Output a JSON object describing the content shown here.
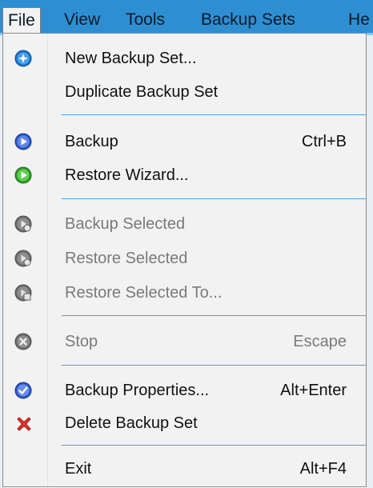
{
  "menubar": {
    "items": [
      {
        "label": "File"
      },
      {
        "label": "View"
      },
      {
        "label": "Tools"
      },
      {
        "label": "Backup Sets"
      },
      {
        "label": "He"
      }
    ]
  },
  "file_menu": {
    "items": [
      {
        "label": "New Backup Set...",
        "shortcut": "",
        "icon": "new-backup-set-icon"
      },
      {
        "label": "Duplicate Backup Set",
        "shortcut": "",
        "icon": ""
      },
      {
        "label": "Backup",
        "shortcut": "Ctrl+B",
        "icon": "backup-play-icon"
      },
      {
        "label": "Restore Wizard...",
        "shortcut": "",
        "icon": "restore-play-icon"
      },
      {
        "label": "Backup Selected",
        "shortcut": "",
        "icon": "backup-selected-icon",
        "disabled": true
      },
      {
        "label": "Restore Selected",
        "shortcut": "",
        "icon": "restore-selected-icon",
        "disabled": true
      },
      {
        "label": "Restore Selected To...",
        "shortcut": "",
        "icon": "restore-selected-to-icon",
        "disabled": true
      },
      {
        "label": "Stop",
        "shortcut": "Escape",
        "icon": "stop-icon",
        "disabled": true
      },
      {
        "label": "Backup Properties...",
        "shortcut": "Alt+Enter",
        "icon": "backup-properties-icon"
      },
      {
        "label": "Delete Backup Set",
        "shortcut": "",
        "icon": "delete-icon"
      },
      {
        "label": "Exit",
        "shortcut": "Alt+F4",
        "icon": ""
      }
    ]
  },
  "colors": {
    "accent": "#2e8ed2",
    "separator": "#4aa3df",
    "menu_bg": "#f2f2f2",
    "disabled_text": "#7a7a7a"
  }
}
